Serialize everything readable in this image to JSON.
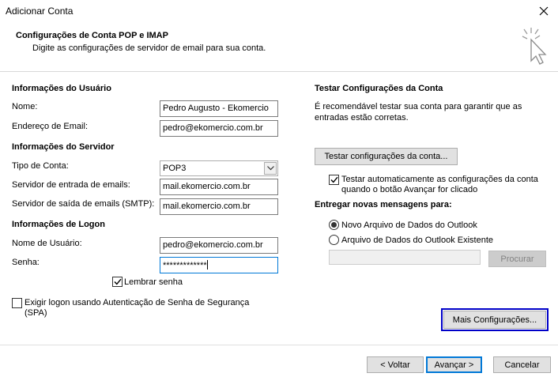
{
  "window": {
    "title": "Adicionar Conta"
  },
  "header": {
    "title": "Configurações de Conta POP e IMAP",
    "subtitle": "Digite as configurações de servidor de email para sua conta."
  },
  "user_info": {
    "section": "Informações do Usuário",
    "name_label": "Nome:",
    "name_value": "Pedro Augusto - Ekomercio",
    "email_label": "Endereço de Email:",
    "email_value": "pedro@ekomercio.com.br"
  },
  "server_info": {
    "section": "Informações do Servidor",
    "account_type_label": "Tipo de Conta:",
    "account_type_value": "POP3",
    "incoming_label": "Servidor de entrada de emails:",
    "incoming_value": "mail.ekomercio.com.br",
    "outgoing_label": "Servidor de saída de emails (SMTP):",
    "outgoing_value": "mail.ekomercio.com.br"
  },
  "logon_info": {
    "section": "Informações de Logon",
    "username_label": "Nome de Usuário:",
    "username_value": "pedro@ekomercio.com.br",
    "password_label": "Senha:",
    "password_value": "*************",
    "remember_label": "Lembrar senha",
    "remember_checked": true,
    "spa_label": "Exigir logon usando Autenticação de Senha de Segurança (SPA)",
    "spa_checked": false
  },
  "test": {
    "section": "Testar Configurações da Conta",
    "description": "É recomendável testar sua conta para garantir que as entradas estão corretas.",
    "test_button": "Testar configurações da conta...",
    "auto_test_label": "Testar automaticamente as configurações da conta quando o botão Avançar for clicado",
    "auto_test_checked": true
  },
  "delivery": {
    "section": "Entregar novas mensagens para:",
    "option_new": "Novo Arquivo de Dados do Outlook",
    "option_existing": "Arquivo de Dados do Outlook Existente",
    "selected": "new",
    "path_value": "",
    "browse_button": "Procurar"
  },
  "more_settings_button": "Mais Configurações...",
  "footer": {
    "back_button": "< Voltar",
    "next_button": "Avançar >",
    "cancel_button": "Cancelar"
  },
  "colors": {
    "accent": "#0078d7",
    "focus_outline": "#0000c8",
    "separator": "#a0a0a0"
  }
}
